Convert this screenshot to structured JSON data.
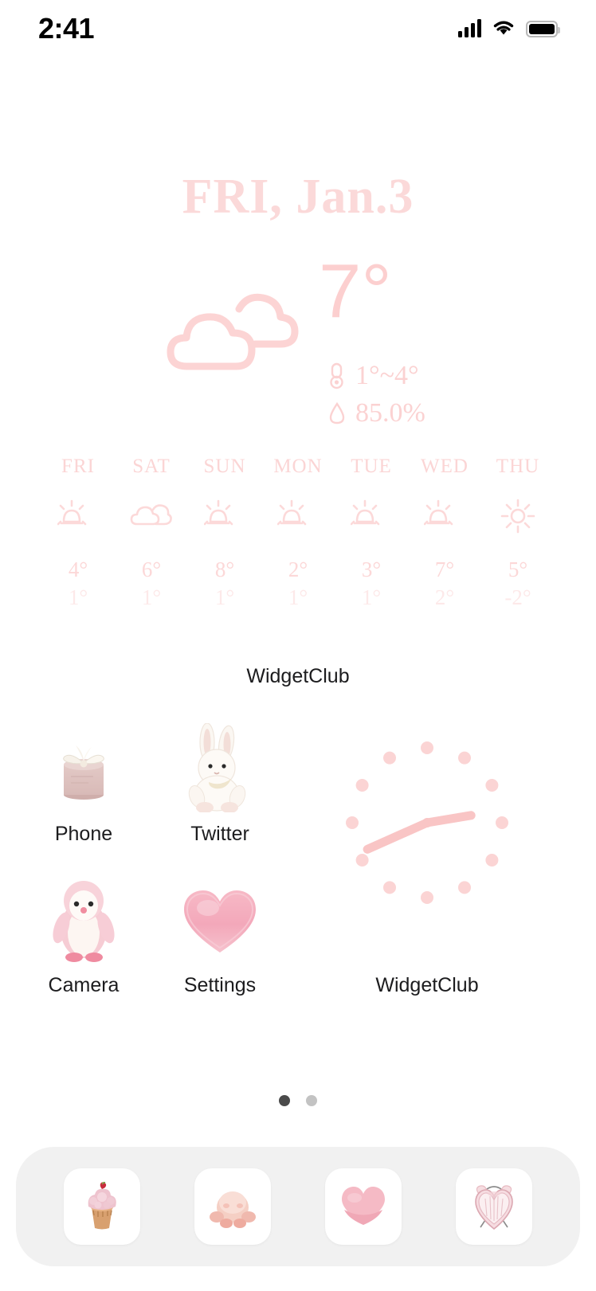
{
  "status_bar": {
    "time": "2:41",
    "cellular_icon": "cellular-signal-icon",
    "wifi_icon": "wifi-icon",
    "battery_icon": "battery-full-icon"
  },
  "date_header": {
    "text": "FRI, Jan.3",
    "color": "#fbd9d9"
  },
  "weather": {
    "condition_icon": "cloudy-icon",
    "temperature": "7°",
    "temp_range_icon": "thermometer-icon",
    "temp_range": "1°~4°",
    "humidity_icon": "water-drop-icon",
    "humidity": "85.0%",
    "accent_color": "#fccfcf"
  },
  "forecast": {
    "type": "table",
    "days": [
      {
        "day": "FRI",
        "icon": "partly-cloudy-icon",
        "high": "4°",
        "low": "1°"
      },
      {
        "day": "SAT",
        "icon": "cloudy-icon",
        "high": "6°",
        "low": "1°"
      },
      {
        "day": "SUN",
        "icon": "partly-cloudy-icon",
        "high": "8°",
        "low": "1°"
      },
      {
        "day": "MON",
        "icon": "partly-cloudy-icon",
        "high": "2°",
        "low": "1°"
      },
      {
        "day": "TUE",
        "icon": "partly-cloudy-icon",
        "high": "3°",
        "low": "1°"
      },
      {
        "day": "WED",
        "icon": "partly-cloudy-icon",
        "high": "7°",
        "low": "2°"
      },
      {
        "day": "THU",
        "icon": "sunny-icon",
        "high": "5°",
        "low": "-2°"
      }
    ]
  },
  "widget_label_top": "WidgetClub",
  "apps": [
    {
      "label": "Phone",
      "icon": "pink-gift-box-icon"
    },
    {
      "label": "Twitter",
      "icon": "bunny-plush-icon"
    },
    {
      "label": "Camera",
      "icon": "pink-penguin-plush-icon"
    },
    {
      "label": "Settings",
      "icon": "pink-heart-icon"
    }
  ],
  "clock_widget": {
    "label": "WidgetClub",
    "hour": 2,
    "minute": 41,
    "marker_color": "#fbd4d4",
    "hand_color": "#f9c5c5"
  },
  "page_dots": {
    "count": 2,
    "active_index": 0
  },
  "dock": {
    "items": [
      {
        "icon": "cupcake-icon"
      },
      {
        "icon": "pink-round-plush-icon"
      },
      {
        "icon": "pink-heart-macaron-icon"
      },
      {
        "icon": "heart-alarm-clock-icon"
      }
    ]
  }
}
